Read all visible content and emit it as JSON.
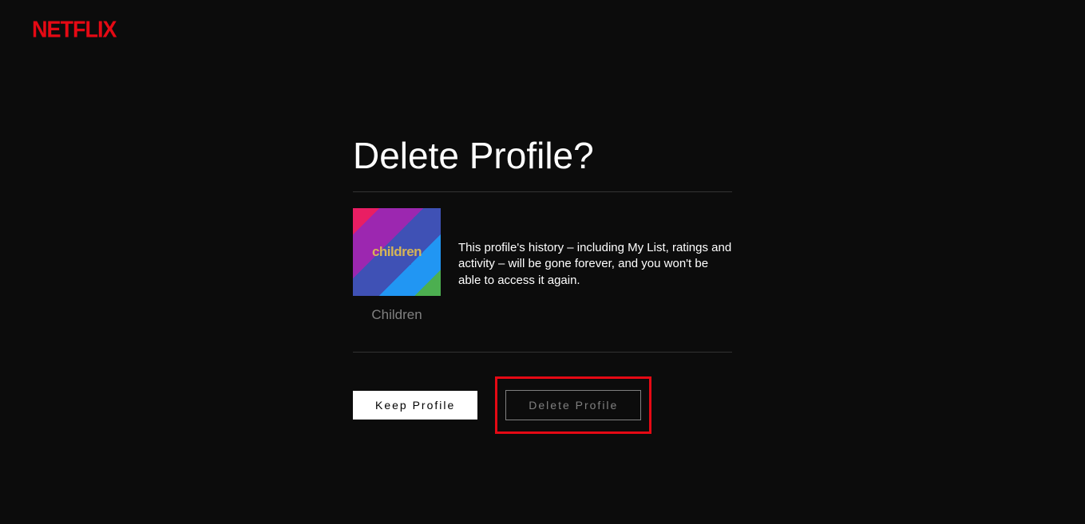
{
  "brand": "NETFLIX",
  "dialog": {
    "title": "Delete Profile?",
    "profile": {
      "name": "Children",
      "avatar_label": "children"
    },
    "warning": "This profile's history – including My List, ratings and activity – will be gone forever, and you won't be able to access it again.",
    "keep_label": "Keep Profile",
    "delete_label": "Delete Profile"
  }
}
